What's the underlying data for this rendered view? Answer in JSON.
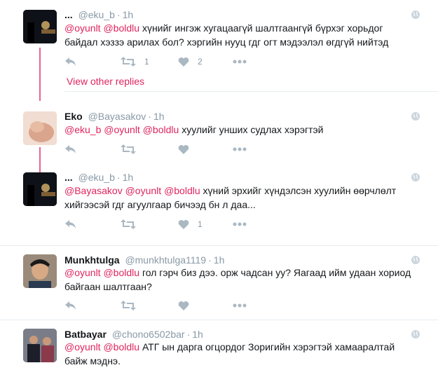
{
  "tweets": [
    {
      "name": "...",
      "handle": "@eku_b",
      "time": "1h",
      "line1_mentions": [
        "@oyunlt",
        "@boldlu"
      ],
      "line1_text": "хүнийг ингэж хугацаагүй шалтгаангүй бүрхэг хорьдог",
      "line2_text": "байдал хэззэ арилах бол? хэргийн нууц гдг огт мэдээлэл өгдгүй нийтэд",
      "reply_count": "",
      "retweet_count": "1",
      "like_count": "2"
    },
    {
      "name": "Eko",
      "handle": "@Bayasakov",
      "time": "1h",
      "line1_mentions": [
        "@eku_b",
        "@oyunlt",
        "@boldlu"
      ],
      "line1_text": "хуулийг унших судлах хэрэгтэй",
      "retweet_count": "",
      "like_count": ""
    },
    {
      "name": "...",
      "handle": "@eku_b",
      "time": "1h",
      "line1_mentions": [
        "@Bayasakov",
        "@oyunlt",
        "@boldlu"
      ],
      "line1_text": "хүний эрхийг хүндэлсэн хуулийн өөрчлөлт",
      "line2_text": "хийгээсэй гдг агуулгаар бичээд бн л даа...",
      "retweet_count": "",
      "like_count": "1"
    },
    {
      "name": "Munkhtulga",
      "handle": "@munkhtulga1119",
      "time": "1h",
      "line1_mentions": [
        "@oyunlt",
        "@boldlu"
      ],
      "line1_text": "гол гэрч биз дээ. орж чадсан уу? Яагаад ийм удаан хориод",
      "line2_text": "байгаан шалтгаан?",
      "retweet_count": "",
      "like_count": ""
    },
    {
      "name": "Batbayar",
      "handle": "@chono6502bar",
      "time": "1h",
      "line1_mentions": [
        "@oyunlt",
        "@boldlu"
      ],
      "line1_text": "АТГ ын дарга огцордог Зоригийн хэрэгтэй хамааралтай",
      "line2_text": "байж мэднэ."
    }
  ],
  "thread": {
    "view_other_replies": "View other replies"
  },
  "colors": {
    "accent": "#e0245e",
    "muted": "#8899a6",
    "icon": "#aab8c2",
    "separator": "#e6ecf0"
  }
}
